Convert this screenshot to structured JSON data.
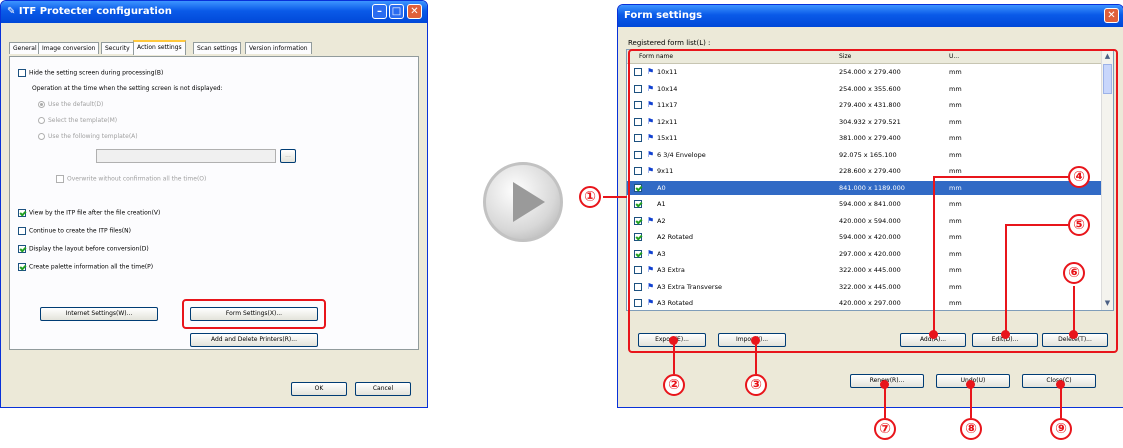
{
  "left_window": {
    "title": "ITF Protecter configuration",
    "tabs": [
      "General",
      "Image conversion",
      "Security",
      "Action settings",
      "Scan settings",
      "Version information"
    ],
    "hide_label": "Hide the setting screen during processing(B)",
    "operation_label": "Operation at the time when the setting screen is not displayed:",
    "radio1": "Use the default(D)",
    "radio2": "Select the template(M)",
    "radio3": "Use the following template(A)",
    "browse": "...",
    "overwrite": "Overwrite without confirmation all the time(O)",
    "check1": "View by the ITP file after the file creation(V)",
    "check2": "Continue to create the ITP files(N)",
    "check3": "Display the layout before conversion(D)",
    "check4": "Create palette information all the time(P)",
    "internet_btn": "Internet Settings(W)...",
    "form_btn": "Form Settings(X)...",
    "printers_btn": "Add and Delete Printers(R)...",
    "ok": "OK",
    "cancel": "Cancel"
  },
  "right_window": {
    "title": "Form settings",
    "list_label": "Registered form list(L) :",
    "columns": [
      "Form name",
      "Size",
      "U..."
    ],
    "rows": [
      {
        "name": "10x11",
        "size": "254.000 x 279.400",
        "unit": "mm",
        "checked": false,
        "flag": true,
        "selected": false
      },
      {
        "name": "10x14",
        "size": "254.000 x 355.600",
        "unit": "mm",
        "checked": false,
        "flag": true,
        "selected": false
      },
      {
        "name": "11x17",
        "size": "279.400 x 431.800",
        "unit": "mm",
        "checked": false,
        "flag": true,
        "selected": false
      },
      {
        "name": "12x11",
        "size": "304.932 x 279.521",
        "unit": "mm",
        "checked": false,
        "flag": true,
        "selected": false
      },
      {
        "name": "15x11",
        "size": "381.000 x 279.400",
        "unit": "mm",
        "checked": false,
        "flag": true,
        "selected": false
      },
      {
        "name": "6 3/4 Envelope",
        "size": "92.075 x 165.100",
        "unit": "mm",
        "checked": false,
        "flag": true,
        "selected": false
      },
      {
        "name": "9x11",
        "size": "228.600 x 279.400",
        "unit": "mm",
        "checked": false,
        "flag": true,
        "selected": false
      },
      {
        "name": "A0",
        "size": "841.000 x 1189.000",
        "unit": "mm",
        "checked": true,
        "flag": false,
        "selected": true
      },
      {
        "name": "A1",
        "size": "594.000 x 841.000",
        "unit": "mm",
        "checked": true,
        "flag": false,
        "selected": false
      },
      {
        "name": "A2",
        "size": "420.000 x 594.000",
        "unit": "mm",
        "checked": true,
        "flag": true,
        "selected": false
      },
      {
        "name": "A2 Rotated",
        "size": "594.000 x 420.000",
        "unit": "mm",
        "checked": true,
        "flag": false,
        "selected": false
      },
      {
        "name": "A3",
        "size": "297.000 x 420.000",
        "unit": "mm",
        "checked": true,
        "flag": true,
        "selected": false
      },
      {
        "name": "A3 Extra",
        "size": "322.000 x 445.000",
        "unit": "mm",
        "checked": false,
        "flag": true,
        "selected": false
      },
      {
        "name": "A3 Extra Transverse",
        "size": "322.000 x 445.000",
        "unit": "mm",
        "checked": false,
        "flag": true,
        "selected": false
      },
      {
        "name": "A3 Rotated",
        "size": "420.000 x 297.000",
        "unit": "mm",
        "checked": false,
        "flag": true,
        "selected": false
      }
    ],
    "export_btn": "Export(E)...",
    "import_btn": "Import(I)...",
    "add_btn": "Add(A)...",
    "edit_btn": "Edit(D)...",
    "delete_btn": "Delete(T)...",
    "renew_btn": "Renew(R)...",
    "undo_btn": "Undo(U)",
    "close_btn": "Close(C)"
  },
  "callouts": [
    "①",
    "②",
    "③",
    "④",
    "⑤",
    "⑥",
    "⑦",
    "⑧",
    "⑨"
  ],
  "colors": {
    "highlight": "#e8151b",
    "titlebar": "#0a5ae8",
    "selection": "#316ac5"
  }
}
